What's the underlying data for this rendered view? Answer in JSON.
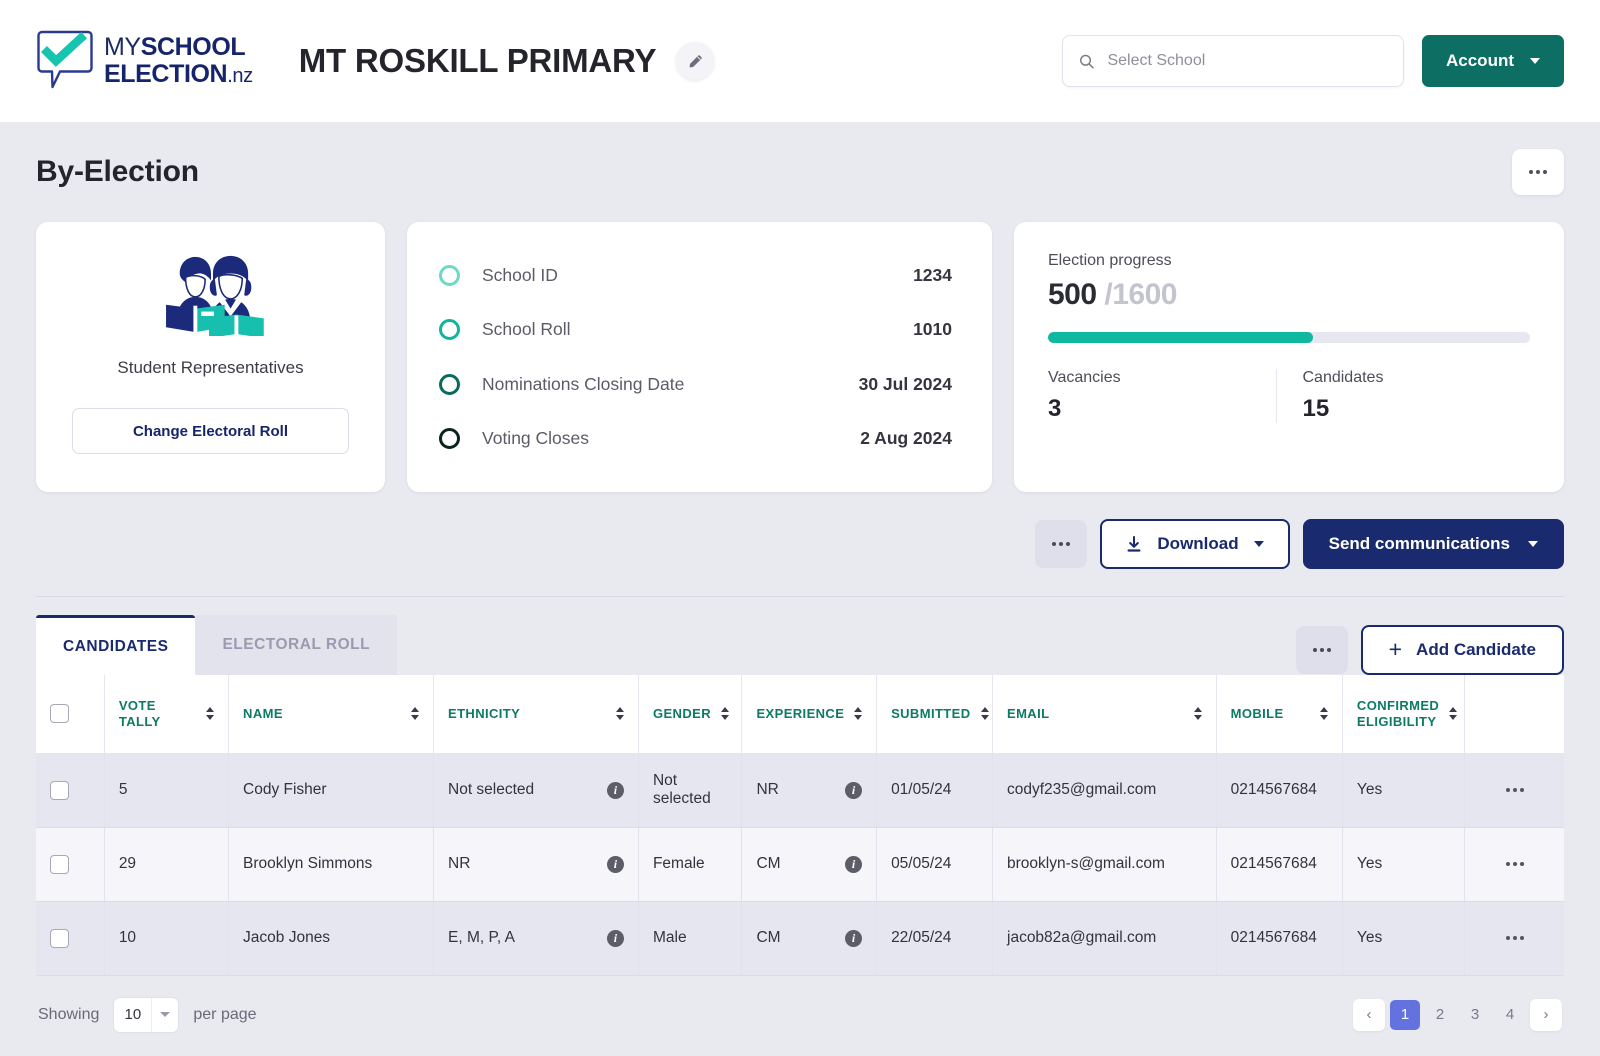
{
  "brand": {
    "line1_thin": "MY",
    "line1_bold": "SCHOOL",
    "line2_bold": "ELECTION",
    "line2_suffix": ".nz",
    "logo_icon": "speech-bubble-check-logo",
    "check_color": "#17c4b0",
    "navy": "#16246b"
  },
  "header": {
    "school_name": "MT ROSKILL PRIMARY",
    "edit_icon": "pencil-icon",
    "search": {
      "icon": "search-icon",
      "placeholder": "Select School",
      "value": ""
    },
    "account_label": "Account",
    "account_caret": "chevron-down-icon",
    "account_color": "#0d6e63"
  },
  "page": {
    "title": "By-Election",
    "overflow_icon": "more-horizontal-icon"
  },
  "roll_card": {
    "illustration": "two-students-reading-books-icon",
    "label": "Student Representatives",
    "button_label": "Change Electoral Roll"
  },
  "details_card": {
    "rows": [
      {
        "icon": "circle-outline-icon",
        "label": "School ID",
        "value": "1234",
        "ring_color": "#6fd9c8"
      },
      {
        "icon": "circle-outline-icon",
        "label": "School Roll",
        "value": "1010",
        "ring_color": "#11b49c"
      },
      {
        "icon": "circle-outline-icon",
        "label": "Nominations Closing Date",
        "value": "30 Jul 2024",
        "ring_color": "#0a6b5c"
      },
      {
        "icon": "circle-outline-icon",
        "label": "Voting Closes",
        "value": "2 Aug 2024",
        "ring_color": "#0c241f"
      }
    ]
  },
  "progress_card": {
    "title": "Election progress",
    "current": "500",
    "total": "/1600",
    "percent": 55,
    "bar_color": "#0fb9a0",
    "stats": [
      {
        "label": "Vacancies",
        "value": "3"
      },
      {
        "label": "Candidates",
        "value": "15"
      }
    ]
  },
  "actions": {
    "overflow_icon": "more-horizontal-icon",
    "download_label": "Download",
    "download_icon": "download-icon",
    "download_caret": "chevron-down-icon",
    "send_label": "Send communications",
    "send_caret": "chevron-down-icon"
  },
  "tabs": {
    "items": [
      {
        "label": "CANDIDATES",
        "active": true
      },
      {
        "label": "ELECTORAL ROLL",
        "active": false
      }
    ],
    "overflow_icon": "more-horizontal-icon",
    "add_label": "Add Candidate",
    "add_icon": "plus-icon"
  },
  "table": {
    "columns": [
      {
        "key": "select",
        "label": "",
        "sortable": false
      },
      {
        "key": "vote_tally",
        "label": "VOTE TALLY",
        "sortable": true
      },
      {
        "key": "name",
        "label": "NAME",
        "sortable": true
      },
      {
        "key": "ethnicity",
        "label": "ETHNICITY",
        "sortable": true
      },
      {
        "key": "gender",
        "label": "GENDER",
        "sortable": true
      },
      {
        "key": "experience",
        "label": "EXPERIENCE",
        "sortable": true
      },
      {
        "key": "submitted",
        "label": "SUBMITTED",
        "sortable": true
      },
      {
        "key": "email",
        "label": "EMAIL",
        "sortable": true
      },
      {
        "key": "mobile",
        "label": "MOBILE",
        "sortable": true
      },
      {
        "key": "confirmed",
        "label": "CONFIRMED ELIGIBILITY",
        "sortable": true
      },
      {
        "key": "actions",
        "label": "",
        "sortable": false
      }
    ],
    "rows": [
      {
        "vote_tally": "5",
        "name": "Cody Fisher",
        "ethnicity": "Not selected",
        "gender": "Not selected",
        "experience": "NR",
        "submitted": "01/05/24",
        "email": "codyf235@gmail.com",
        "mobile": "0214567684",
        "confirmed": "Yes"
      },
      {
        "vote_tally": "29",
        "name": "Brooklyn Simmons",
        "ethnicity": "NR",
        "gender": "Female",
        "experience": "CM",
        "submitted": "05/05/24",
        "email": "brooklyn-s@gmail.com",
        "mobile": "0214567684",
        "confirmed": "Yes"
      },
      {
        "vote_tally": "10",
        "name": "Jacob Jones",
        "ethnicity": "E, M, P, A",
        "gender": "Male",
        "experience": "CM",
        "submitted": "22/05/24",
        "email": "jacob82a@gmail.com",
        "mobile": "0214567684",
        "confirmed": "Yes"
      }
    ],
    "row_info_icon": "info-icon",
    "row_overflow_icon": "more-horizontal-icon"
  },
  "footer": {
    "showing_label": "Showing",
    "per_page_value": "10",
    "per_page_label": "per page",
    "prev_icon": "chevron-left-icon",
    "next_icon": "chevron-right-icon",
    "pages": [
      "1",
      "2",
      "3",
      "4"
    ],
    "current_page": "1",
    "current_page_color": "#6472e0"
  }
}
